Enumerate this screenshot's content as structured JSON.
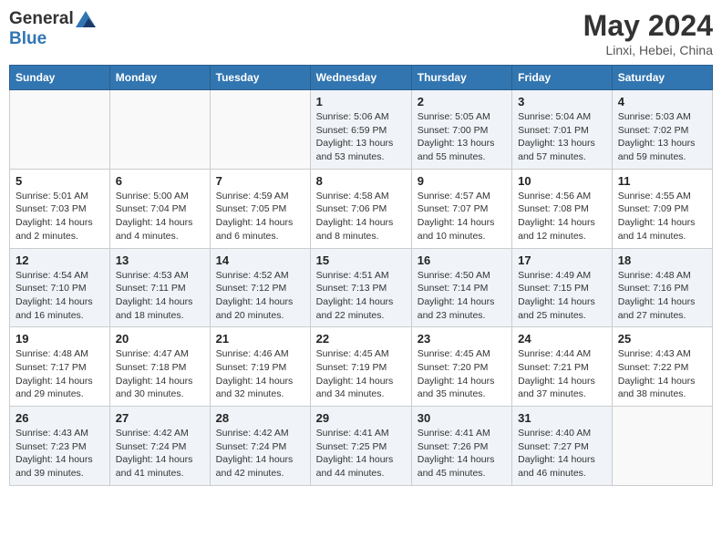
{
  "header": {
    "logo_line1": "General",
    "logo_line2": "Blue",
    "month": "May 2024",
    "location": "Linxi, Hebei, China"
  },
  "weekdays": [
    "Sunday",
    "Monday",
    "Tuesday",
    "Wednesday",
    "Thursday",
    "Friday",
    "Saturday"
  ],
  "weeks": [
    [
      {
        "day": "",
        "sunrise": "",
        "sunset": "",
        "daylight": ""
      },
      {
        "day": "",
        "sunrise": "",
        "sunset": "",
        "daylight": ""
      },
      {
        "day": "",
        "sunrise": "",
        "sunset": "",
        "daylight": ""
      },
      {
        "day": "1",
        "sunrise": "Sunrise: 5:06 AM",
        "sunset": "Sunset: 6:59 PM",
        "daylight": "Daylight: 13 hours and 53 minutes."
      },
      {
        "day": "2",
        "sunrise": "Sunrise: 5:05 AM",
        "sunset": "Sunset: 7:00 PM",
        "daylight": "Daylight: 13 hours and 55 minutes."
      },
      {
        "day": "3",
        "sunrise": "Sunrise: 5:04 AM",
        "sunset": "Sunset: 7:01 PM",
        "daylight": "Daylight: 13 hours and 57 minutes."
      },
      {
        "day": "4",
        "sunrise": "Sunrise: 5:03 AM",
        "sunset": "Sunset: 7:02 PM",
        "daylight": "Daylight: 13 hours and 59 minutes."
      }
    ],
    [
      {
        "day": "5",
        "sunrise": "Sunrise: 5:01 AM",
        "sunset": "Sunset: 7:03 PM",
        "daylight": "Daylight: 14 hours and 2 minutes."
      },
      {
        "day": "6",
        "sunrise": "Sunrise: 5:00 AM",
        "sunset": "Sunset: 7:04 PM",
        "daylight": "Daylight: 14 hours and 4 minutes."
      },
      {
        "day": "7",
        "sunrise": "Sunrise: 4:59 AM",
        "sunset": "Sunset: 7:05 PM",
        "daylight": "Daylight: 14 hours and 6 minutes."
      },
      {
        "day": "8",
        "sunrise": "Sunrise: 4:58 AM",
        "sunset": "Sunset: 7:06 PM",
        "daylight": "Daylight: 14 hours and 8 minutes."
      },
      {
        "day": "9",
        "sunrise": "Sunrise: 4:57 AM",
        "sunset": "Sunset: 7:07 PM",
        "daylight": "Daylight: 14 hours and 10 minutes."
      },
      {
        "day": "10",
        "sunrise": "Sunrise: 4:56 AM",
        "sunset": "Sunset: 7:08 PM",
        "daylight": "Daylight: 14 hours and 12 minutes."
      },
      {
        "day": "11",
        "sunrise": "Sunrise: 4:55 AM",
        "sunset": "Sunset: 7:09 PM",
        "daylight": "Daylight: 14 hours and 14 minutes."
      }
    ],
    [
      {
        "day": "12",
        "sunrise": "Sunrise: 4:54 AM",
        "sunset": "Sunset: 7:10 PM",
        "daylight": "Daylight: 14 hours and 16 minutes."
      },
      {
        "day": "13",
        "sunrise": "Sunrise: 4:53 AM",
        "sunset": "Sunset: 7:11 PM",
        "daylight": "Daylight: 14 hours and 18 minutes."
      },
      {
        "day": "14",
        "sunrise": "Sunrise: 4:52 AM",
        "sunset": "Sunset: 7:12 PM",
        "daylight": "Daylight: 14 hours and 20 minutes."
      },
      {
        "day": "15",
        "sunrise": "Sunrise: 4:51 AM",
        "sunset": "Sunset: 7:13 PM",
        "daylight": "Daylight: 14 hours and 22 minutes."
      },
      {
        "day": "16",
        "sunrise": "Sunrise: 4:50 AM",
        "sunset": "Sunset: 7:14 PM",
        "daylight": "Daylight: 14 hours and 23 minutes."
      },
      {
        "day": "17",
        "sunrise": "Sunrise: 4:49 AM",
        "sunset": "Sunset: 7:15 PM",
        "daylight": "Daylight: 14 hours and 25 minutes."
      },
      {
        "day": "18",
        "sunrise": "Sunrise: 4:48 AM",
        "sunset": "Sunset: 7:16 PM",
        "daylight": "Daylight: 14 hours and 27 minutes."
      }
    ],
    [
      {
        "day": "19",
        "sunrise": "Sunrise: 4:48 AM",
        "sunset": "Sunset: 7:17 PM",
        "daylight": "Daylight: 14 hours and 29 minutes."
      },
      {
        "day": "20",
        "sunrise": "Sunrise: 4:47 AM",
        "sunset": "Sunset: 7:18 PM",
        "daylight": "Daylight: 14 hours and 30 minutes."
      },
      {
        "day": "21",
        "sunrise": "Sunrise: 4:46 AM",
        "sunset": "Sunset: 7:19 PM",
        "daylight": "Daylight: 14 hours and 32 minutes."
      },
      {
        "day": "22",
        "sunrise": "Sunrise: 4:45 AM",
        "sunset": "Sunset: 7:19 PM",
        "daylight": "Daylight: 14 hours and 34 minutes."
      },
      {
        "day": "23",
        "sunrise": "Sunrise: 4:45 AM",
        "sunset": "Sunset: 7:20 PM",
        "daylight": "Daylight: 14 hours and 35 minutes."
      },
      {
        "day": "24",
        "sunrise": "Sunrise: 4:44 AM",
        "sunset": "Sunset: 7:21 PM",
        "daylight": "Daylight: 14 hours and 37 minutes."
      },
      {
        "day": "25",
        "sunrise": "Sunrise: 4:43 AM",
        "sunset": "Sunset: 7:22 PM",
        "daylight": "Daylight: 14 hours and 38 minutes."
      }
    ],
    [
      {
        "day": "26",
        "sunrise": "Sunrise: 4:43 AM",
        "sunset": "Sunset: 7:23 PM",
        "daylight": "Daylight: 14 hours and 39 minutes."
      },
      {
        "day": "27",
        "sunrise": "Sunrise: 4:42 AM",
        "sunset": "Sunset: 7:24 PM",
        "daylight": "Daylight: 14 hours and 41 minutes."
      },
      {
        "day": "28",
        "sunrise": "Sunrise: 4:42 AM",
        "sunset": "Sunset: 7:24 PM",
        "daylight": "Daylight: 14 hours and 42 minutes."
      },
      {
        "day": "29",
        "sunrise": "Sunrise: 4:41 AM",
        "sunset": "Sunset: 7:25 PM",
        "daylight": "Daylight: 14 hours and 44 minutes."
      },
      {
        "day": "30",
        "sunrise": "Sunrise: 4:41 AM",
        "sunset": "Sunset: 7:26 PM",
        "daylight": "Daylight: 14 hours and 45 minutes."
      },
      {
        "day": "31",
        "sunrise": "Sunrise: 4:40 AM",
        "sunset": "Sunset: 7:27 PM",
        "daylight": "Daylight: 14 hours and 46 minutes."
      },
      {
        "day": "",
        "sunrise": "",
        "sunset": "",
        "daylight": ""
      }
    ]
  ]
}
